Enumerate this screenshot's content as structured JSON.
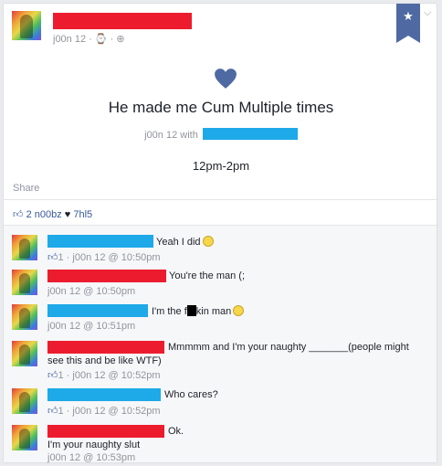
{
  "post": {
    "meta": "j00n 12 · ",
    "meta_icons": [
      "clock-icon",
      "globe-icon"
    ],
    "title": "He made me Cum Multiple times",
    "with_prefix": "j00n 12 with",
    "time_range": "12pm-2pm",
    "share_label": "Share",
    "likes_text": "2 n00bz",
    "hearts_text": "7hl5",
    "heart_color": "#4f6aa3",
    "bookmark_icon": "star-icon"
  },
  "comments": [
    {
      "text": "Yeah I did",
      "emoji": true,
      "likes": "1",
      "meta": "j00n 12 @ 10:50pm"
    },
    {
      "text": "You're the man (;",
      "emoji": false,
      "likes": "",
      "meta": "j00n 12 @ 10:50pm"
    },
    {
      "text_a": "I'm the f",
      "text_b": "kin man",
      "emoji": true,
      "likes": "",
      "meta": "j00n 12 @ 10:51pm"
    },
    {
      "text": "Mmmmm and I'm your naughty _______(people might",
      "text2": "see this and be like WTF)",
      "likes": "1",
      "meta": "j00n 12 @ 10:52pm"
    },
    {
      "text": "Who cares?",
      "likes": "1",
      "meta": "j00n 12 @ 10:52pm"
    },
    {
      "text": "Ok.",
      "text2": "I'm your naughty slut",
      "likes": "",
      "meta": "j00n 12 @ 10:53pm"
    }
  ],
  "colors": {
    "redact_red": "#ec1c2e",
    "redact_blue": "#1ea9e8",
    "link": "#365899"
  }
}
